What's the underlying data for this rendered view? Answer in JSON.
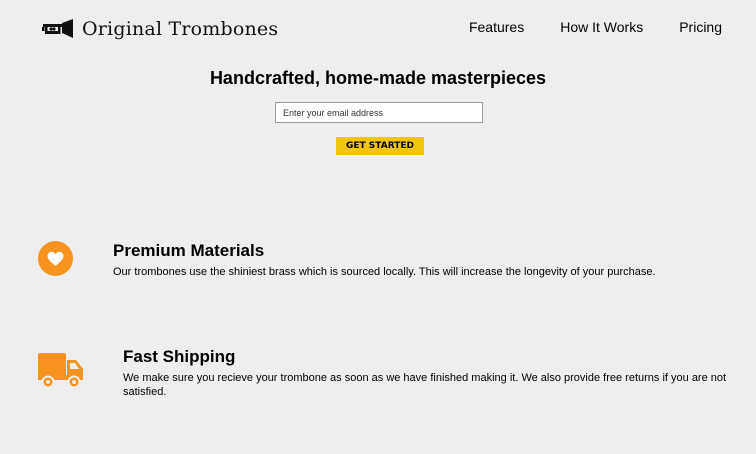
{
  "brand": {
    "name": "Original Trombones",
    "logo_icon": "trombone-icon"
  },
  "nav": {
    "items": [
      "Features",
      "How It Works",
      "Pricing"
    ]
  },
  "hero": {
    "title": "Handcrafted, home-made masterpieces",
    "email_placeholder": "Enter your email address",
    "cta_label": "GET STARTED"
  },
  "features": [
    {
      "icon": "heart-icon",
      "title": "Premium Materials",
      "text": "Our trombones use the shiniest brass which is sourced locally. This will increase the longevity of your purchase."
    },
    {
      "icon": "truck-icon",
      "title": "Fast Shipping",
      "text": "We make sure you recieve your trombone as soon as we have finished making it. We also provide free returns if you are not satisfied."
    }
  ],
  "colors": {
    "accent_orange": "#f7931e",
    "cta_yellow": "#f1c40f",
    "background": "#eeeeee"
  }
}
